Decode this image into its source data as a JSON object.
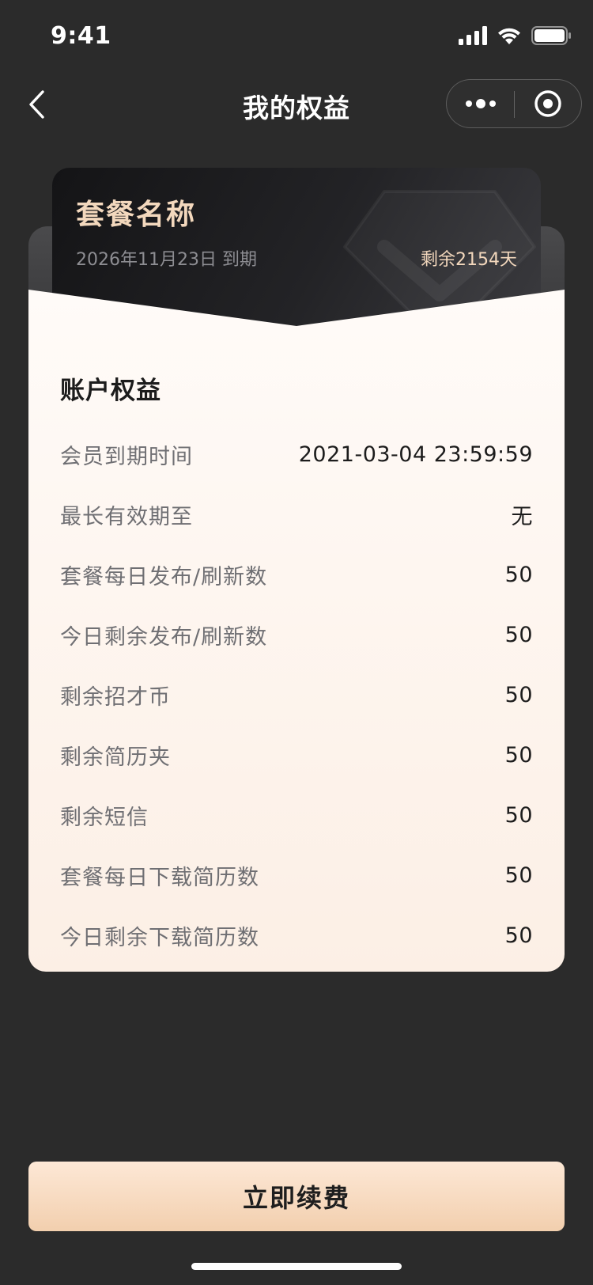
{
  "status_bar": {
    "time": "9:41"
  },
  "nav": {
    "title": "我的权益"
  },
  "card": {
    "name": "套餐名称",
    "expire_text": "2026年11月23日 到期",
    "remaining_text": "剩余2154天"
  },
  "rights": {
    "title": "账户权益",
    "rows": [
      {
        "label": "会员到期时间",
        "value": "2021-03-04 23:59:59"
      },
      {
        "label": "最长有效期至",
        "value": "无"
      },
      {
        "label": "套餐每日发布/刷新数",
        "value": "50"
      },
      {
        "label": "今日剩余发布/刷新数",
        "value": "50"
      },
      {
        "label": "剩余招才币",
        "value": "50"
      },
      {
        "label": "剩余简历夹",
        "value": "50"
      },
      {
        "label": "剩余短信",
        "value": "50"
      },
      {
        "label": "套餐每日下载简历数",
        "value": "50"
      },
      {
        "label": "今日剩余下载简历数",
        "value": "50"
      }
    ]
  },
  "actions": {
    "renew_label": "立即续费"
  },
  "colors": {
    "background": "#2b2b2b",
    "card_gold": "#f3d8bd",
    "button_gradient_top": "#fde8d6",
    "button_gradient_bottom": "#f2cfae"
  },
  "icons": {
    "status": [
      "cellular-signal-icon",
      "wifi-icon",
      "battery-icon"
    ],
    "nav": [
      "back-chevron-icon",
      "more-dots-icon",
      "close-target-icon"
    ]
  }
}
